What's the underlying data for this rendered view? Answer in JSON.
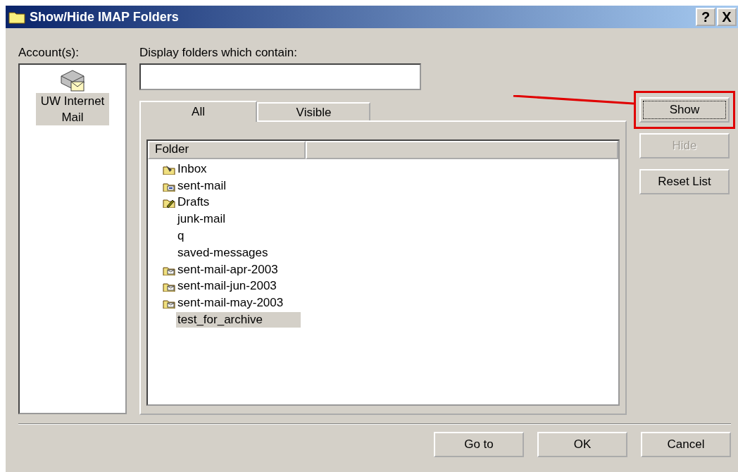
{
  "window": {
    "title": "Show/Hide IMAP Folders",
    "help_button": "?",
    "close_button": "X"
  },
  "accounts": {
    "label": "Account(s):",
    "items": [
      {
        "name": "UW Internet Mail",
        "selected": true
      }
    ]
  },
  "filter": {
    "label": "Display folders which contain:"
  },
  "tabs": [
    {
      "label": "All",
      "selected": true
    },
    {
      "label": "Visible",
      "selected": false
    }
  ],
  "folder_list": {
    "columns": [
      "Folder"
    ],
    "rows": [
      {
        "name": "Inbox",
        "kind": "inbox",
        "selected": false
      },
      {
        "name": "sent-mail",
        "kind": "sent",
        "selected": false
      },
      {
        "name": "Drafts",
        "kind": "drafts",
        "selected": false
      },
      {
        "name": "junk-mail",
        "kind": "plain",
        "selected": false
      },
      {
        "name": "q",
        "kind": "plain",
        "selected": false
      },
      {
        "name": "saved-messages",
        "kind": "plain",
        "selected": false
      },
      {
        "name": "sent-mail-apr-2003",
        "kind": "mail",
        "selected": false
      },
      {
        "name": "sent-mail-jun-2003",
        "kind": "mail",
        "selected": false
      },
      {
        "name": "sent-mail-may-2003",
        "kind": "mail",
        "selected": false
      },
      {
        "name": "test_for_archive",
        "kind": "plain",
        "selected": true
      }
    ]
  },
  "side_buttons": [
    {
      "label": "Show",
      "disabled": false,
      "focused": true,
      "highlighted": true
    },
    {
      "label": "Hide",
      "disabled": true,
      "focused": false,
      "highlighted": false
    },
    {
      "label": "Reset List",
      "disabled": false,
      "focused": false,
      "highlighted": false
    }
  ],
  "bottom_buttons": [
    {
      "label": "Go to"
    },
    {
      "label": "OK"
    },
    {
      "label": "Cancel"
    }
  ]
}
